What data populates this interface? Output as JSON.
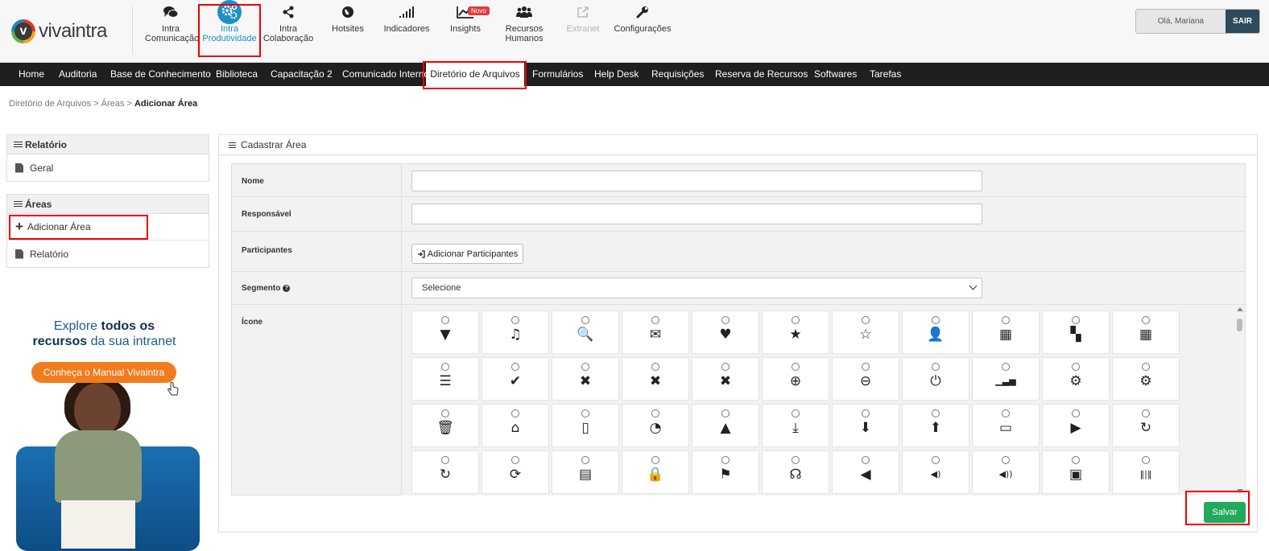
{
  "brand": {
    "logo_letter": "v",
    "name": "vivaintra"
  },
  "modules": [
    {
      "label1": "Intra",
      "label2": "Comunicação",
      "icon": "chat-icon"
    },
    {
      "label1": "Intra",
      "label2": "Produtividade",
      "icon": "gears-icon",
      "active": true
    },
    {
      "label1": "Intra",
      "label2": "Colaboração",
      "icon": "share-icon"
    },
    {
      "label1": "Hotsites",
      "label2": "",
      "icon": "globe-icon"
    },
    {
      "label1": "Indicadores",
      "label2": "",
      "icon": "signal-icon"
    },
    {
      "label1": "Insights",
      "label2": "",
      "icon": "trend-icon",
      "badge": "Novo"
    },
    {
      "label1": "Recursos",
      "label2": "Humanos",
      "icon": "people-icon"
    },
    {
      "label1": "Extranet",
      "label2": "",
      "icon": "external-icon",
      "disabled": true
    },
    {
      "label1": "Configurações",
      "label2": "",
      "icon": "wrench-icon"
    }
  ],
  "user": {
    "greeting": "Olá, Mariana",
    "logout": "SAIR"
  },
  "menu": [
    "Home",
    "Auditoria",
    "Base de Conhecimento",
    "Biblioteca",
    "Capacitação 2",
    "Comunicado Interno",
    "Diretório de Arquivos",
    "Formulários",
    "Help Desk",
    "Requisições",
    "Reserva de Recursos",
    "Softwares",
    "Tarefas"
  ],
  "menu_active": "Diretório de Arquivos",
  "breadcrumb": {
    "item1": "Diretório de Arquivos",
    "sep": ">",
    "item2": "Áreas",
    "current": "Adicionar Área"
  },
  "sidebar": {
    "report_section": {
      "title": "Relatório",
      "items": [
        "Geral"
      ]
    },
    "areas_section": {
      "title": "Áreas",
      "items": [
        "Adicionar Área",
        "Relatório"
      ]
    }
  },
  "ad": {
    "line1_pre": "Explore",
    "line1_bold": "todos os",
    "line2_bold": "recursos",
    "line2_post": "da sua intranet",
    "button": "Conheça o Manual Vivaintra"
  },
  "form": {
    "title": "Cadastrar Área",
    "fields": {
      "nome": {
        "label": "Nome",
        "value": ""
      },
      "responsavel": {
        "label": "Responsável",
        "value": ""
      },
      "participantes": {
        "label": "Participantes",
        "button": "Adicionar Participantes"
      },
      "segmento": {
        "label": "Segmento",
        "selected": "Selecione"
      },
      "icone": {
        "label": "Ícone"
      }
    },
    "icons": [
      [
        "filter-icon",
        "music-icon",
        "search-icon",
        "envelope-icon",
        "heart-icon",
        "star-icon",
        "star-empty-icon",
        "user-icon",
        "film-icon",
        "th-large-icon",
        "th-icon"
      ],
      [
        "th-list-icon",
        "ok-icon",
        "remove-icon",
        "remove-icon",
        "remove-icon",
        "zoom-in-icon",
        "zoom-out-icon",
        "off-icon",
        "signal-icon",
        "cog-icon",
        "cog-icon"
      ],
      [
        "trash-icon",
        "home-icon",
        "file-icon",
        "time-icon",
        "road-icon",
        "download-alt-icon",
        "download-icon",
        "upload-icon",
        "inbox-icon",
        "play-circle-icon",
        "repeat-icon"
      ],
      [
        "repeat-icon",
        "refresh-icon",
        "list-alt-icon",
        "lock-icon",
        "flag-icon",
        "headphones-icon",
        "volume-off-icon",
        "volume-down-icon",
        "volume-up-icon",
        "qrcode-icon",
        "barcode-icon"
      ]
    ],
    "save": "Salvar"
  },
  "colors": {
    "accent": "#1f8fc6",
    "menubar": "#1f1f1f",
    "save": "#22a95b",
    "highlight": "#ee0000"
  }
}
